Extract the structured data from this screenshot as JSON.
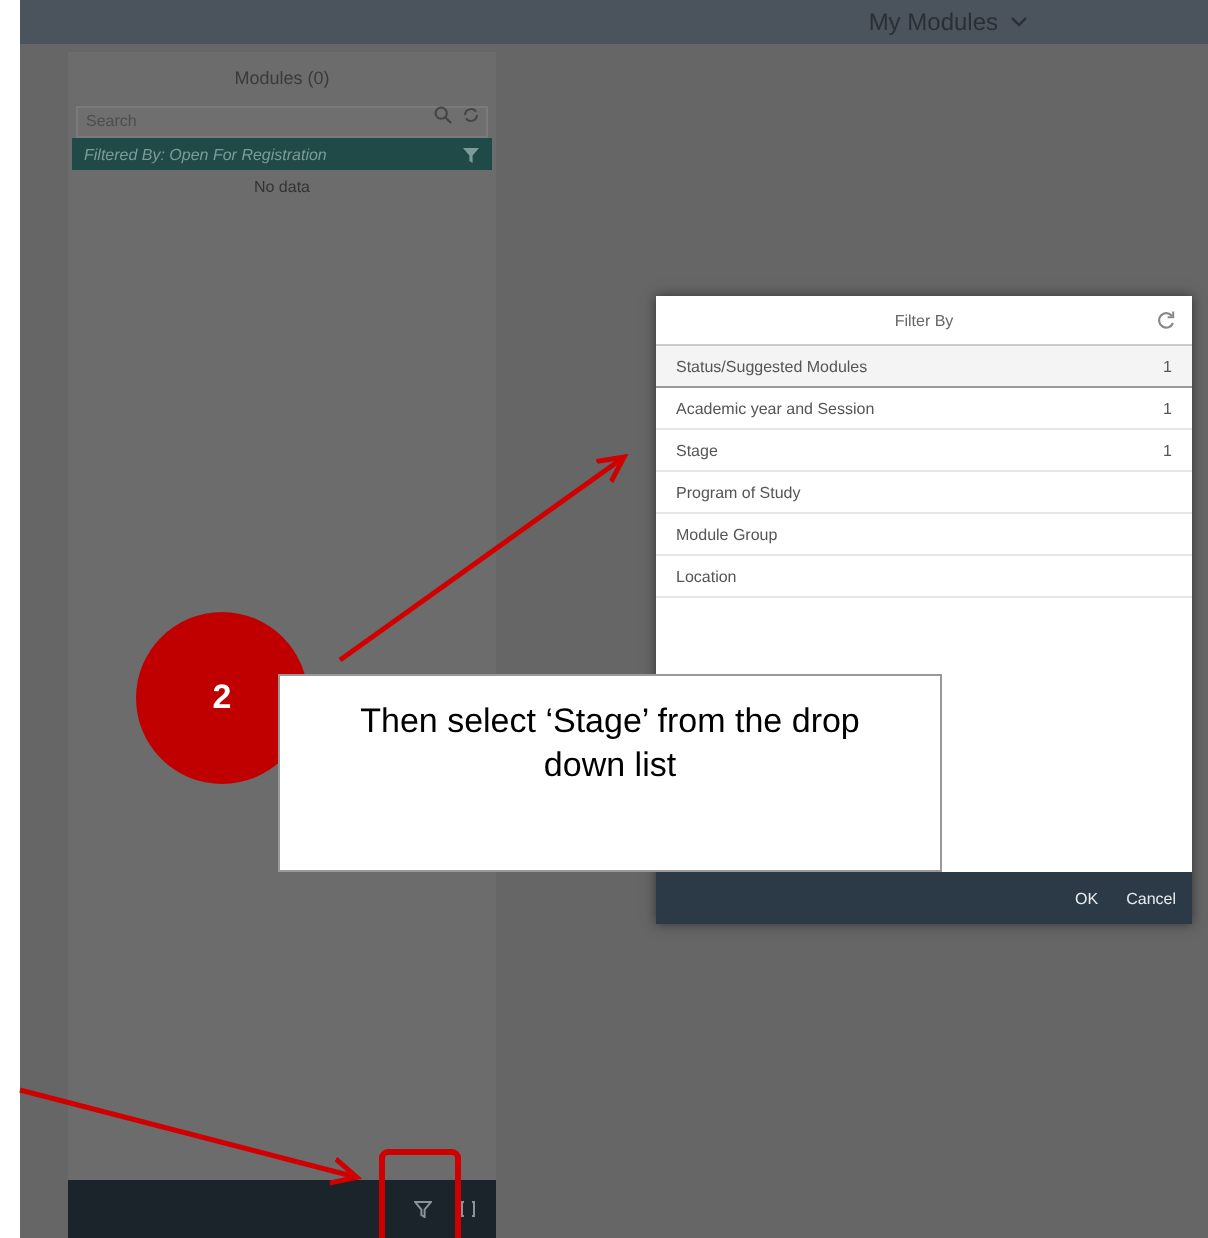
{
  "header": {
    "title": "My Modules"
  },
  "modules_panel": {
    "title": "Modules (0)",
    "search": {
      "placeholder": "Search"
    },
    "filter_banner": "Filtered By: Open For Registration",
    "empty_text": "No data"
  },
  "filter_dialog": {
    "title": "Filter By",
    "items": [
      {
        "label": "Status/Suggested Modules",
        "count": "1",
        "selected": true
      },
      {
        "label": "Academic year and Session",
        "count": "1",
        "selected": false
      },
      {
        "label": "Stage",
        "count": "1",
        "selected": false
      },
      {
        "label": "Program of Study",
        "selected": false
      },
      {
        "label": "Module Group",
        "selected": false
      },
      {
        "label": "Location",
        "selected": false
      }
    ],
    "buttons": [
      "OK",
      "Cancel"
    ]
  },
  "callout": {
    "step": "2",
    "text": "Then select ‘Stage’ from the drop down list"
  }
}
